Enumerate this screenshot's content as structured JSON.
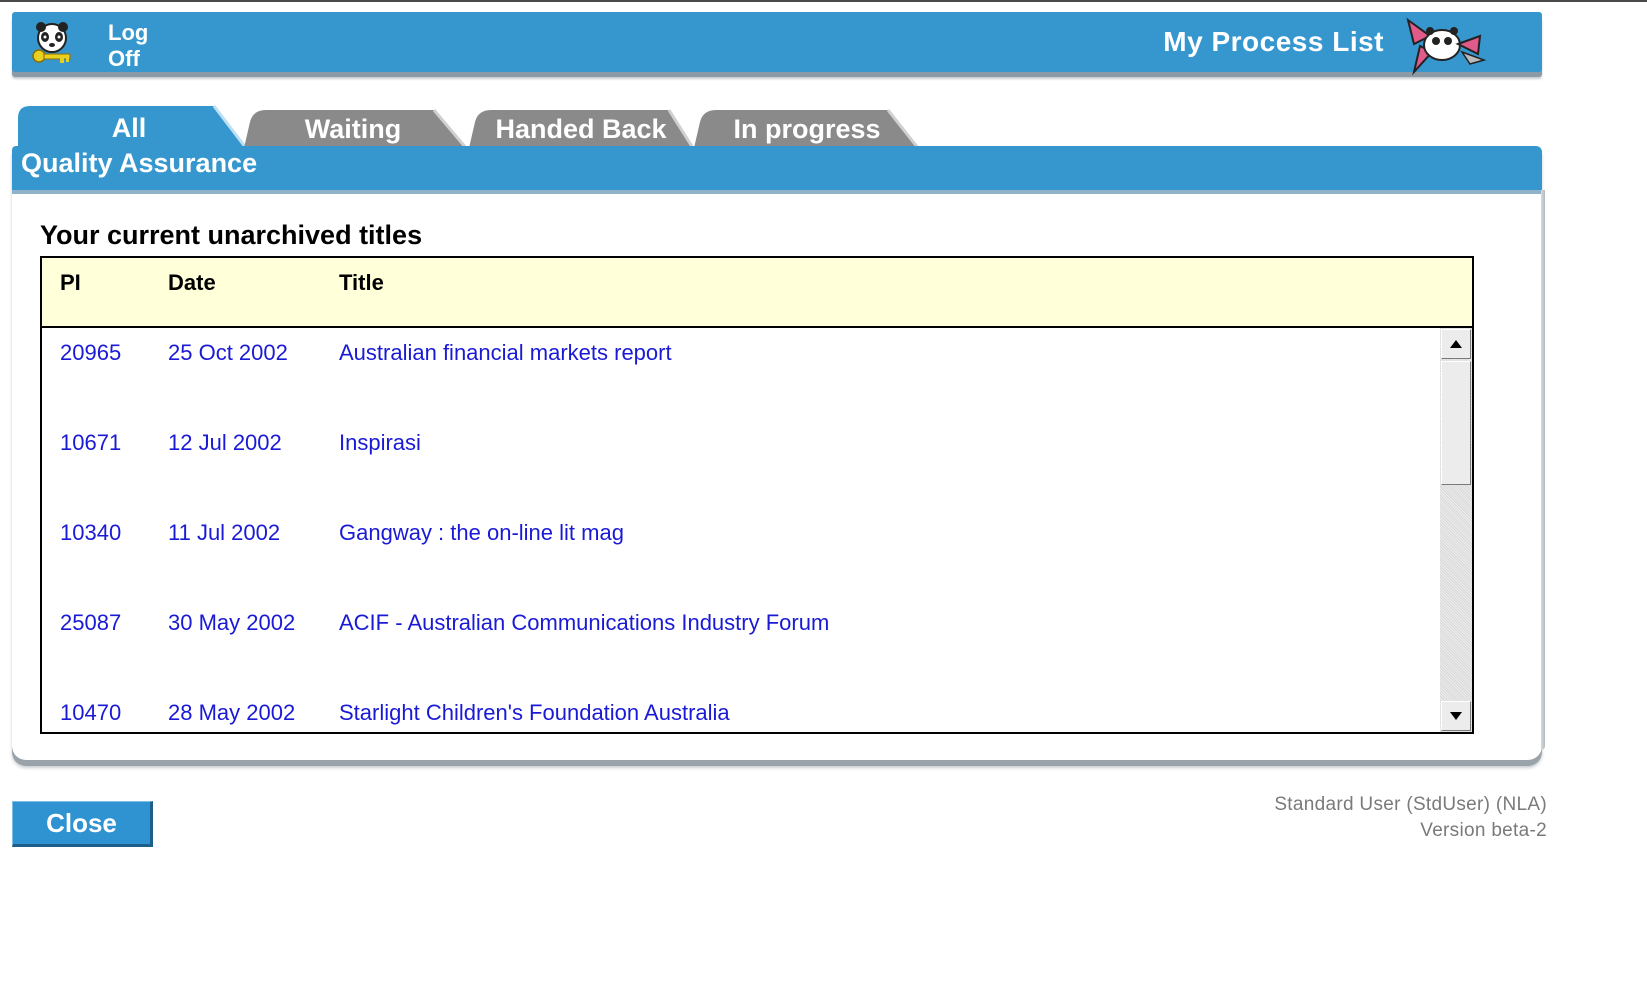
{
  "header": {
    "logoff_line1": "Log",
    "logoff_line2": "Off",
    "title": "My Process List",
    "logoff_icon": "panda-key-icon",
    "title_icon": "panda-fly-icon"
  },
  "tabs": [
    {
      "label": "All",
      "active": true
    },
    {
      "label": "Waiting",
      "active": false
    },
    {
      "label": "Handed Back",
      "active": false
    },
    {
      "label": "In progress",
      "active": false
    }
  ],
  "panel": {
    "title": "Quality Assurance",
    "heading": "Your current unarchived titles"
  },
  "table": {
    "columns": [
      "PI",
      "Date",
      "Title"
    ],
    "rows": [
      {
        "pi": "20965",
        "date": "25 Oct 2002",
        "title": "Australian financial markets report"
      },
      {
        "pi": "10671",
        "date": "12 Jul 2002",
        "title": "Inspirasi"
      },
      {
        "pi": "10340",
        "date": "11 Jul 2002",
        "title": "Gangway : the on-line lit mag"
      },
      {
        "pi": "25087",
        "date": "30 May 2002",
        "title": "ACIF - Australian Communications Industry Forum"
      },
      {
        "pi": "10470",
        "date": "28 May 2002",
        "title": "Starlight Children's Foundation Australia"
      }
    ]
  },
  "footer": {
    "close_label": "Close",
    "user": "Standard User (StdUser) (NLA)",
    "version": "Version beta-2"
  },
  "colors": {
    "brand_blue": "#3697cf",
    "tab_gray": "#8a8a8a",
    "link_blue": "#1a1ad6",
    "table_header_bg": "#ffffd9"
  }
}
